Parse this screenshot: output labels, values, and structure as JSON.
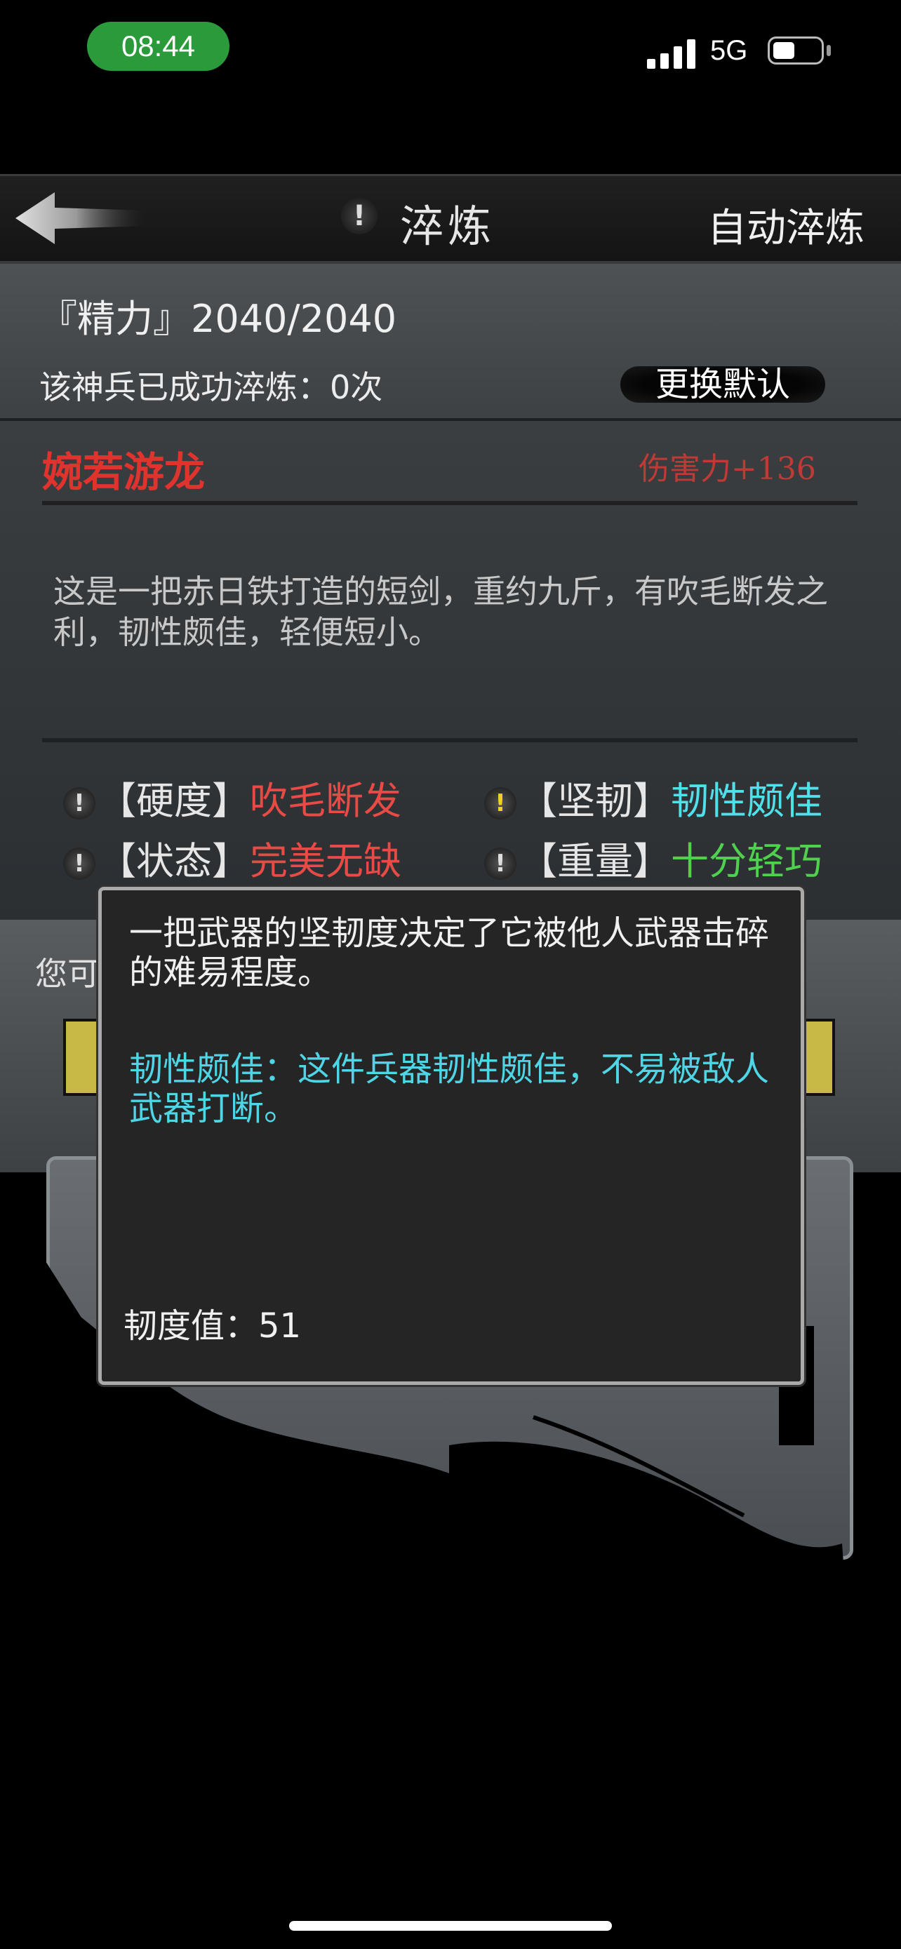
{
  "status_bar": {
    "time": "08:44",
    "network": "5G",
    "icons": [
      "signal-icon",
      "battery-icon"
    ]
  },
  "header": {
    "title": "淬炼",
    "auto_button": "自动淬炼",
    "alert_mark": "!",
    "icons": [
      "back-arrow-icon",
      "alert-icon"
    ]
  },
  "info": {
    "stamina": "『精力』2040/2040",
    "refine_count": "该神兵已成功淬炼：0次",
    "change_default": "更换默认"
  },
  "weapon": {
    "name": "婉若游龙",
    "damage": "伤害力+136",
    "description": "这是一把赤日铁打造的短剑，重约九斤，有吹毛断发之利，韧性颇佳，轻便短小。"
  },
  "attributes": [
    {
      "key": "【硬度】",
      "value": "吹毛断发",
      "color": "#e84a45",
      "alert_color": "white"
    },
    {
      "key": "【坚韧】",
      "value": "韧性颇佳",
      "color": "#4fe0ea",
      "alert_color": "yellow"
    },
    {
      "key": "【状态】",
      "value": "完美无缺",
      "color": "#e84a45",
      "alert_color": "white"
    },
    {
      "key": "【重量】",
      "value": "十分轻巧",
      "color": "#4fd04f",
      "alert_color": "white"
    }
  ],
  "lower": {
    "you_can": "您可"
  },
  "tooltip": {
    "text": "一把武器的坚韧度决定了它被他人武器击碎的难易程度。",
    "detail": "韧性颇佳：这件兵器韧性颇佳，不易被敌人武器打断。",
    "value": "韧度值：51"
  },
  "colors": {
    "status_time_bg": "#2a9a3a",
    "weapon_name": "#e0332e",
    "tooltip_detail": "#4fd6e6"
  }
}
